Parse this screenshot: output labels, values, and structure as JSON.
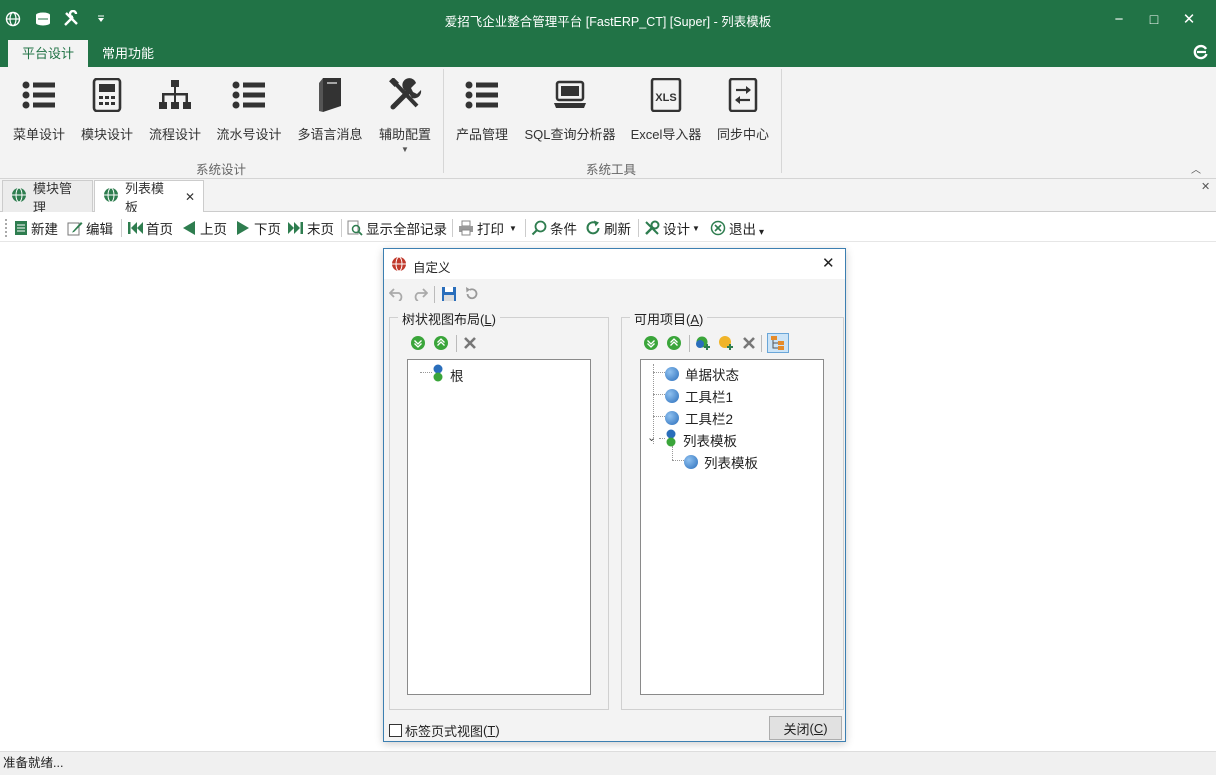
{
  "window": {
    "title": "爱招飞企业整合管理平台 [FastERP_CT] [Super] - 列表模板",
    "controls": {
      "minimize": "−",
      "maximize": "□",
      "close": "✕"
    }
  },
  "ribbon_tabs": [
    "平台设计",
    "常用功能"
  ],
  "ribbon": {
    "groups": [
      {
        "label": "系统设计",
        "buttons": [
          "菜单设计",
          "模块设计",
          "流程设计",
          "流水号设计",
          "多语言消息",
          "辅助配置"
        ]
      },
      {
        "label": "系统工具",
        "buttons": [
          "产品管理",
          "SQL查询分析器",
          "Excel导入器",
          "同步中心"
        ]
      }
    ],
    "xls_text": "XLS"
  },
  "doc_tabs": [
    {
      "label": "模块管理",
      "close": ""
    },
    {
      "label": "列表模板",
      "close": "✕"
    }
  ],
  "doc_close": "✕",
  "toolbar": {
    "new": "新建",
    "edit": "编辑",
    "first": "首页",
    "prev": "上页",
    "next": "下页",
    "last": "末页",
    "show_all": "显示全部记录",
    "print": "打印",
    "condition": "条件",
    "refresh": "刷新",
    "design": "设计",
    "exit": "退出"
  },
  "dialog": {
    "title": "自定义",
    "close_icon": "✕",
    "left_group": {
      "label": "树状视图布局",
      "hotkey": "L",
      "root_node": "根"
    },
    "right_group": {
      "label": "可用项目",
      "hotkey": "A",
      "items": [
        "单据状态",
        "工具栏1",
        "工具栏2",
        "列表模板"
      ],
      "child": "列表模板"
    },
    "tab_view_checkbox": {
      "label": "标签页式视图",
      "hotkey": "T",
      "checked": false
    },
    "close_button": {
      "label": "关闭",
      "hotkey": "C"
    }
  },
  "status": "准备就绪...",
  "colors": {
    "brand": "#217346",
    "dialog_border": "#3c7fb1"
  }
}
